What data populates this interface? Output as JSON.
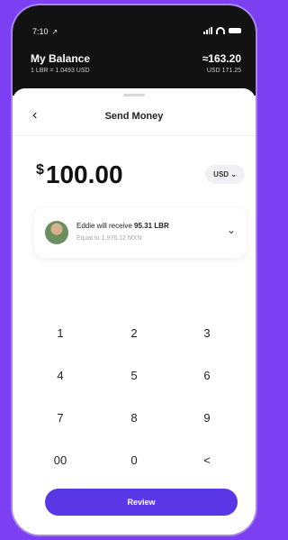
{
  "status_bar": {
    "time": "7:10",
    "location_glyph": "↗"
  },
  "balance": {
    "title": "My Balance",
    "rate": "1 LBR = 1.0493 USD",
    "amount": "≈163.20",
    "usd": "USD 171.25"
  },
  "sheet": {
    "back_glyph": "‹",
    "title": "Send Money"
  },
  "amount": {
    "symbol": "$",
    "value": "100.00",
    "currency": "USD ⌄"
  },
  "recipient": {
    "prefix": "Eddie will receive ",
    "receive_amount": "95.31 LBR",
    "equivalent": "Equal to 1,976.12 MXN",
    "chevron": "⌄"
  },
  "keypad": {
    "keys": [
      "1",
      "2",
      "3",
      "4",
      "5",
      "6",
      "7",
      "8",
      "9",
      "00",
      "0",
      "<"
    ]
  },
  "review_button": {
    "label": "Review"
  },
  "colors": {
    "background": "#7c3ff2",
    "header": "#121212",
    "accent": "#5a37e6"
  },
  "icons": [
    "back-chevron-icon",
    "dropdown-chevron-icon",
    "signal-icon",
    "wifi-icon",
    "battery-icon"
  ]
}
